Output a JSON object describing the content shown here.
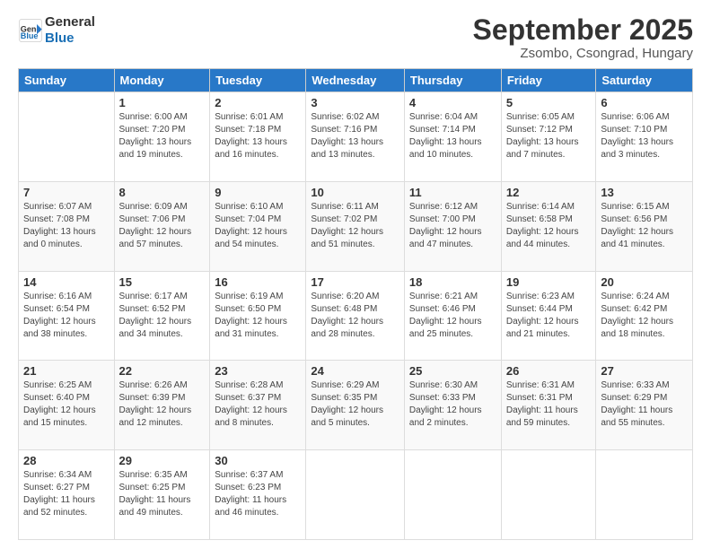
{
  "logo": {
    "line1": "General",
    "line2": "Blue"
  },
  "title": "September 2025",
  "subtitle": "Zsombo, Csongrad, Hungary",
  "days_header": [
    "Sunday",
    "Monday",
    "Tuesday",
    "Wednesday",
    "Thursday",
    "Friday",
    "Saturday"
  ],
  "weeks": [
    [
      {
        "day": "",
        "detail": ""
      },
      {
        "day": "1",
        "detail": "Sunrise: 6:00 AM\nSunset: 7:20 PM\nDaylight: 13 hours\nand 19 minutes."
      },
      {
        "day": "2",
        "detail": "Sunrise: 6:01 AM\nSunset: 7:18 PM\nDaylight: 13 hours\nand 16 minutes."
      },
      {
        "day": "3",
        "detail": "Sunrise: 6:02 AM\nSunset: 7:16 PM\nDaylight: 13 hours\nand 13 minutes."
      },
      {
        "day": "4",
        "detail": "Sunrise: 6:04 AM\nSunset: 7:14 PM\nDaylight: 13 hours\nand 10 minutes."
      },
      {
        "day": "5",
        "detail": "Sunrise: 6:05 AM\nSunset: 7:12 PM\nDaylight: 13 hours\nand 7 minutes."
      },
      {
        "day": "6",
        "detail": "Sunrise: 6:06 AM\nSunset: 7:10 PM\nDaylight: 13 hours\nand 3 minutes."
      }
    ],
    [
      {
        "day": "7",
        "detail": "Sunrise: 6:07 AM\nSunset: 7:08 PM\nDaylight: 13 hours\nand 0 minutes."
      },
      {
        "day": "8",
        "detail": "Sunrise: 6:09 AM\nSunset: 7:06 PM\nDaylight: 12 hours\nand 57 minutes."
      },
      {
        "day": "9",
        "detail": "Sunrise: 6:10 AM\nSunset: 7:04 PM\nDaylight: 12 hours\nand 54 minutes."
      },
      {
        "day": "10",
        "detail": "Sunrise: 6:11 AM\nSunset: 7:02 PM\nDaylight: 12 hours\nand 51 minutes."
      },
      {
        "day": "11",
        "detail": "Sunrise: 6:12 AM\nSunset: 7:00 PM\nDaylight: 12 hours\nand 47 minutes."
      },
      {
        "day": "12",
        "detail": "Sunrise: 6:14 AM\nSunset: 6:58 PM\nDaylight: 12 hours\nand 44 minutes."
      },
      {
        "day": "13",
        "detail": "Sunrise: 6:15 AM\nSunset: 6:56 PM\nDaylight: 12 hours\nand 41 minutes."
      }
    ],
    [
      {
        "day": "14",
        "detail": "Sunrise: 6:16 AM\nSunset: 6:54 PM\nDaylight: 12 hours\nand 38 minutes."
      },
      {
        "day": "15",
        "detail": "Sunrise: 6:17 AM\nSunset: 6:52 PM\nDaylight: 12 hours\nand 34 minutes."
      },
      {
        "day": "16",
        "detail": "Sunrise: 6:19 AM\nSunset: 6:50 PM\nDaylight: 12 hours\nand 31 minutes."
      },
      {
        "day": "17",
        "detail": "Sunrise: 6:20 AM\nSunset: 6:48 PM\nDaylight: 12 hours\nand 28 minutes."
      },
      {
        "day": "18",
        "detail": "Sunrise: 6:21 AM\nSunset: 6:46 PM\nDaylight: 12 hours\nand 25 minutes."
      },
      {
        "day": "19",
        "detail": "Sunrise: 6:23 AM\nSunset: 6:44 PM\nDaylight: 12 hours\nand 21 minutes."
      },
      {
        "day": "20",
        "detail": "Sunrise: 6:24 AM\nSunset: 6:42 PM\nDaylight: 12 hours\nand 18 minutes."
      }
    ],
    [
      {
        "day": "21",
        "detail": "Sunrise: 6:25 AM\nSunset: 6:40 PM\nDaylight: 12 hours\nand 15 minutes."
      },
      {
        "day": "22",
        "detail": "Sunrise: 6:26 AM\nSunset: 6:39 PM\nDaylight: 12 hours\nand 12 minutes."
      },
      {
        "day": "23",
        "detail": "Sunrise: 6:28 AM\nSunset: 6:37 PM\nDaylight: 12 hours\nand 8 minutes."
      },
      {
        "day": "24",
        "detail": "Sunrise: 6:29 AM\nSunset: 6:35 PM\nDaylight: 12 hours\nand 5 minutes."
      },
      {
        "day": "25",
        "detail": "Sunrise: 6:30 AM\nSunset: 6:33 PM\nDaylight: 12 hours\nand 2 minutes."
      },
      {
        "day": "26",
        "detail": "Sunrise: 6:31 AM\nSunset: 6:31 PM\nDaylight: 11 hours\nand 59 minutes."
      },
      {
        "day": "27",
        "detail": "Sunrise: 6:33 AM\nSunset: 6:29 PM\nDaylight: 11 hours\nand 55 minutes."
      }
    ],
    [
      {
        "day": "28",
        "detail": "Sunrise: 6:34 AM\nSunset: 6:27 PM\nDaylight: 11 hours\nand 52 minutes."
      },
      {
        "day": "29",
        "detail": "Sunrise: 6:35 AM\nSunset: 6:25 PM\nDaylight: 11 hours\nand 49 minutes."
      },
      {
        "day": "30",
        "detail": "Sunrise: 6:37 AM\nSunset: 6:23 PM\nDaylight: 11 hours\nand 46 minutes."
      },
      {
        "day": "",
        "detail": ""
      },
      {
        "day": "",
        "detail": ""
      },
      {
        "day": "",
        "detail": ""
      },
      {
        "day": "",
        "detail": ""
      }
    ]
  ]
}
